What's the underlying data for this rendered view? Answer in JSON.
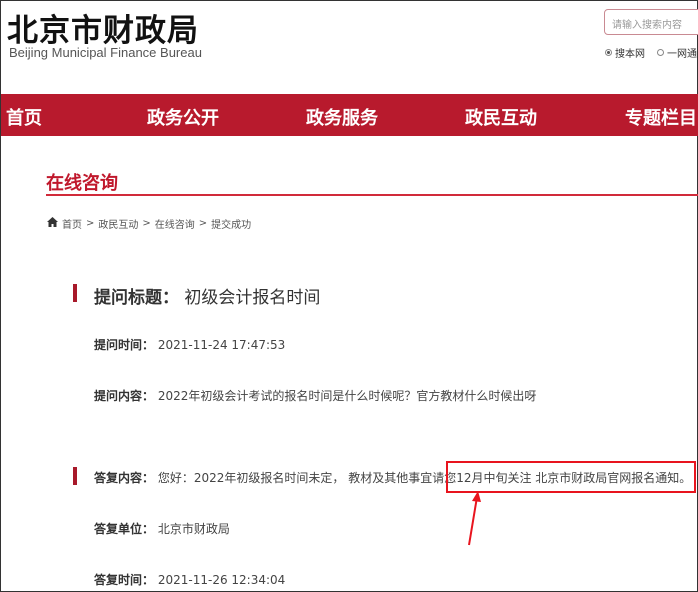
{
  "header": {
    "logo": "北京市财政局",
    "logo_en": "Beijing Municipal Finance Bureau",
    "search_placeholder": "请输入搜索内容",
    "radio": [
      "搜本网",
      "一网通"
    ]
  },
  "nav": [
    "首页",
    "政务公开",
    "政务服务",
    "政民互动",
    "专题栏目"
  ],
  "section_title": "在线咨询",
  "breadcrumb": [
    "首页",
    "政民互动",
    "在线咨询",
    "提交成功"
  ],
  "breadcrumb_sep": ">",
  "detail": {
    "title_label": "提问标题：",
    "title": "初级会计报名时间",
    "time_label": "提问时间：",
    "time": "2021-11-24 17:47:53",
    "content_label": "提问内容：",
    "content": "2022年初级会计考试的报名时间是什么时候呢？官方教材什么时候出呀",
    "reply_label": "答复内容：",
    "reply_a": "您好：2022年初级报名时间未定， 教材及其他事宜请",
    "reply_b": "您12月中旬关注 北京市财政局官网报名通知。",
    "unit_label": "答复单位：",
    "unit": "北京市财政局",
    "reply_time_label": "答复时间：",
    "reply_time": "2021-11-26 12:34:04"
  }
}
